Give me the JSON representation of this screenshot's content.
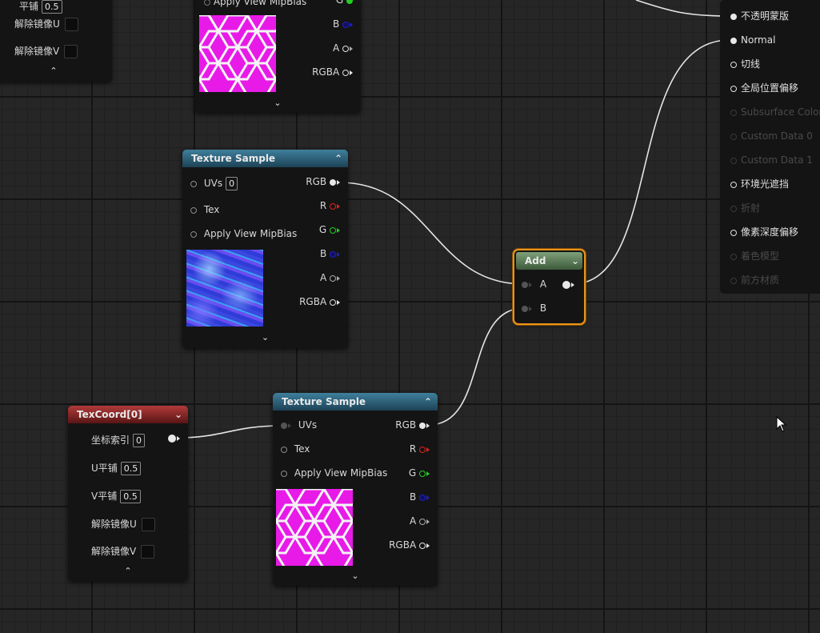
{
  "node_top_right": {
    "rows": {
      "g": "G",
      "b": "B",
      "a": "A",
      "rgba": "RGBA"
    },
    "mipbias": "Apply View MipBias"
  },
  "node_top_left": {
    "partial_label": "平铺",
    "partial_value": "0.5",
    "unmirror_u": "解除镜像U",
    "unmirror_v": "解除镜像V"
  },
  "texture_sample_1": {
    "title": "Texture Sample",
    "uvs_label": "UVs",
    "uvs_value": "0",
    "tex_label": "Tex",
    "mipbias_label": "Apply View MipBias",
    "outputs": {
      "rgb": "RGB",
      "r": "R",
      "g": "G",
      "b": "B",
      "a": "A",
      "rgba": "RGBA"
    }
  },
  "texture_sample_2": {
    "title": "Texture Sample",
    "uvs_label": "UVs",
    "tex_label": "Tex",
    "mipbias_label": "Apply View MipBias",
    "outputs": {
      "rgb": "RGB",
      "r": "R",
      "g": "G",
      "b": "B",
      "a": "A",
      "rgba": "RGBA"
    }
  },
  "texcoord": {
    "title": "TexCoord[0]",
    "index_label": "坐标索引",
    "index_value": "0",
    "utile_label": "U平铺",
    "utile_value": "0.5",
    "vtile_label": "V平铺",
    "vtile_value": "0.5",
    "unmirror_u": "解除镜像U",
    "unmirror_v": "解除镜像V"
  },
  "add_node": {
    "title": "Add",
    "input_a": "A",
    "input_b": "B"
  },
  "material_output": {
    "inputs": [
      {
        "label": "不透明蒙版",
        "enabled": true
      },
      {
        "label": "Normal",
        "enabled": true
      },
      {
        "label": "切线",
        "enabled": true
      },
      {
        "label": "全局位置偏移",
        "enabled": true
      },
      {
        "label": "Subsurface Color",
        "enabled": false
      },
      {
        "label": "Custom Data 0",
        "enabled": false
      },
      {
        "label": "Custom Data 1",
        "enabled": false
      },
      {
        "label": "环境光遮挡",
        "enabled": true
      },
      {
        "label": "折射",
        "enabled": false
      },
      {
        "label": "像素深度偏移",
        "enabled": true
      },
      {
        "label": "着色模型",
        "enabled": false
      },
      {
        "label": "前方材质",
        "enabled": false
      }
    ]
  },
  "colors": {
    "wire": "#e8e8e8",
    "selection": "#e8921a",
    "texture_header": "#2b5a72",
    "texcoord_header": "#8a2424",
    "math_header": "#5a7a57",
    "hex_magenta": "#e81ae8",
    "hex_edge": "#f4f4f4"
  }
}
